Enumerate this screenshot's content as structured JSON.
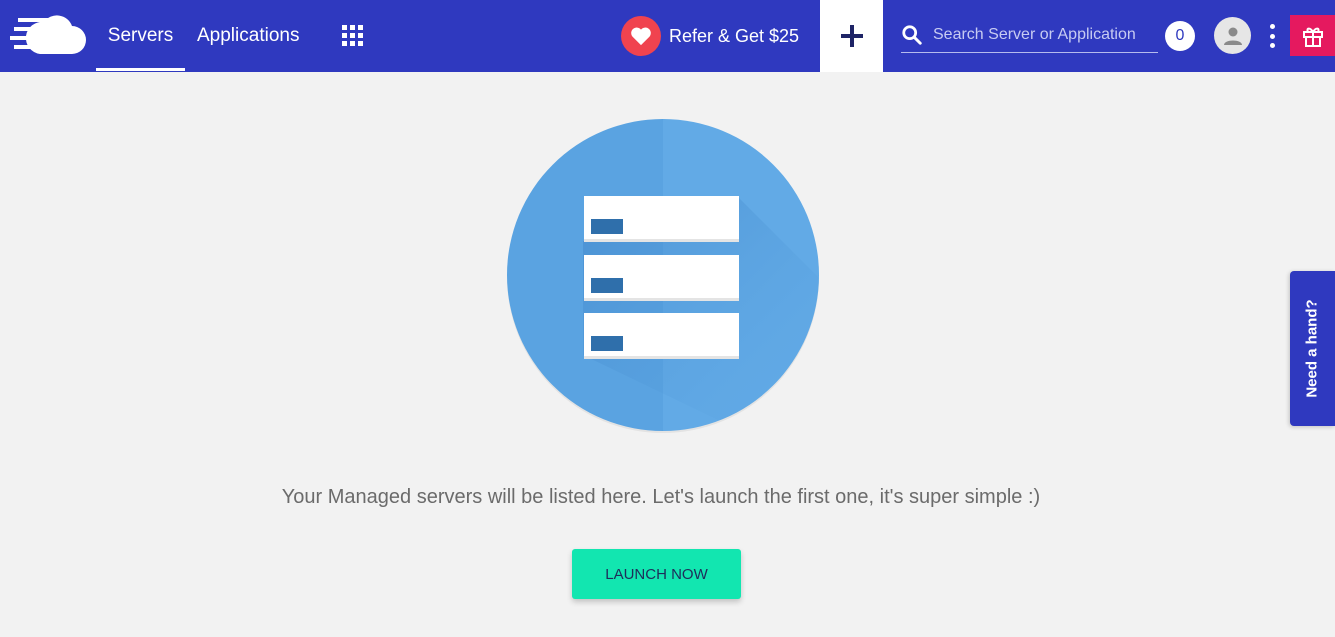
{
  "header": {
    "logo_icon": "cloud-speed-logo",
    "tabs": [
      {
        "label": "Servers",
        "active": true
      },
      {
        "label": "Applications",
        "active": false
      }
    ],
    "apps_grid_icon": "grid-icon",
    "refer": {
      "label": "Refer & Get $25",
      "icon": "heart-icon"
    },
    "add_button_icon": "plus-icon",
    "search": {
      "placeholder": "Search Server or Application",
      "value": "",
      "icon": "search-icon"
    },
    "notification_count": "0",
    "avatar_icon": "user-icon",
    "more_icon": "kebab-icon",
    "gift_icon": "gift-icon"
  },
  "main": {
    "illustration": "servers-stack-illustration",
    "message": "Your Managed servers will be listed here. Let's launch the first one, it's super simple :)",
    "launch_label": "LAUNCH NOW"
  },
  "help_tab": {
    "label": "Need a hand?"
  },
  "colors": {
    "header_bg": "#2f39bf",
    "accent_green": "#12e6b0",
    "refer_red": "#f0434f",
    "gift_pink": "#e5195f",
    "illustration_blue": "#5aa5e3"
  }
}
